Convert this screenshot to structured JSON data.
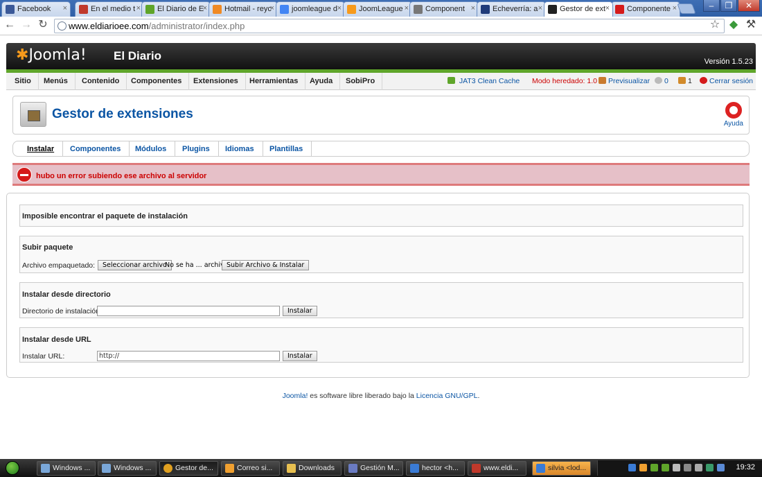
{
  "browser": {
    "tabs": [
      {
        "label": "Facebook",
        "color": "#3b5998",
        "active": false
      },
      {
        "label": "En el medio t",
        "color": "#c0392b",
        "active": false
      },
      {
        "label": "El Diario de E",
        "color": "#5fa52a",
        "active": false
      },
      {
        "label": "Hotmail - reyc",
        "color": "#f08a24",
        "active": false
      },
      {
        "label": "joomleague d",
        "color": "#4285f4",
        "active": false
      },
      {
        "label": "JoomLeague",
        "color": "#f79a1b",
        "active": false
      },
      {
        "label": "Component",
        "color": "#777777",
        "active": false
      },
      {
        "label": "Echeverría: a",
        "color": "#1f3b7a",
        "active": false
      },
      {
        "label": "Gestor de ext",
        "color": "#222222",
        "active": true
      },
      {
        "label": "Componente",
        "color": "#d51b1b",
        "active": false
      }
    ],
    "url_host": "www.eldiarioee.com",
    "url_path": "/administrator/index.php"
  },
  "header": {
    "logo_text": "Joomla!",
    "site_name": "El Diario",
    "version": "Versión 1.5.23"
  },
  "menu": {
    "items": [
      "Sitio",
      "Menús",
      "Contenido",
      "Componentes",
      "Extensiones",
      "Herramientas",
      "Ayuda",
      "SobiPro"
    ],
    "clean_cache": "JAT3 Clean Cache",
    "legacy": "Modo heredado: 1.0",
    "preview": "Previsualizar",
    "messages": "0",
    "users": "1",
    "logout": "Cerrar sesión"
  },
  "page": {
    "title": "Gestor de extensiones",
    "help_label": "Ayuda"
  },
  "submenu": [
    "Instalar",
    "Componentes",
    "Módulos",
    "Plugins",
    "Idiomas",
    "Plantillas"
  ],
  "error_message": "hubo un error subiendo ese archivo al servidor",
  "sections": {
    "not_found": "Imposible encontrar el paquete de instalación",
    "upload": {
      "title": "Subir paquete",
      "label": "Archivo empaquetado:",
      "choose_btn": "Seleccionar archivo",
      "file_status": "No se ha ... archivo",
      "submit_btn": "Subir Archivo & Instalar"
    },
    "directory": {
      "title": "Instalar desde directorio",
      "label": "Directorio de instalación:",
      "value": "",
      "btn": "Instalar"
    },
    "url": {
      "title": "Instalar desde URL",
      "label": "Instalar URL:",
      "value": "http://",
      "btn": "Instalar"
    }
  },
  "footer": {
    "link1": "Joomla!",
    "middle": " es software libre liberado bajo la ",
    "link2": "Licencia GNU/GPL",
    "end": "."
  },
  "taskbar": {
    "tasks": [
      {
        "label": "Windows ...",
        "color": "#7aa7d8"
      },
      {
        "label": "Windows ...",
        "color": "#7aa7d8"
      },
      {
        "label": "Gestor de...",
        "color": "#e0a020"
      },
      {
        "label": "Correo si...",
        "color": "#f0a030"
      },
      {
        "label": "Downloads",
        "color": "#e8c050"
      },
      {
        "label": "Gestión M...",
        "color": "#6a7bc2"
      },
      {
        "label": "hector <h...",
        "color": "#3a7bd5"
      },
      {
        "label": "www.eldi...",
        "color": "#c0392b"
      },
      {
        "label": "silvia <lod...",
        "color": "#3a7bd5"
      }
    ],
    "clock": "19:32"
  }
}
